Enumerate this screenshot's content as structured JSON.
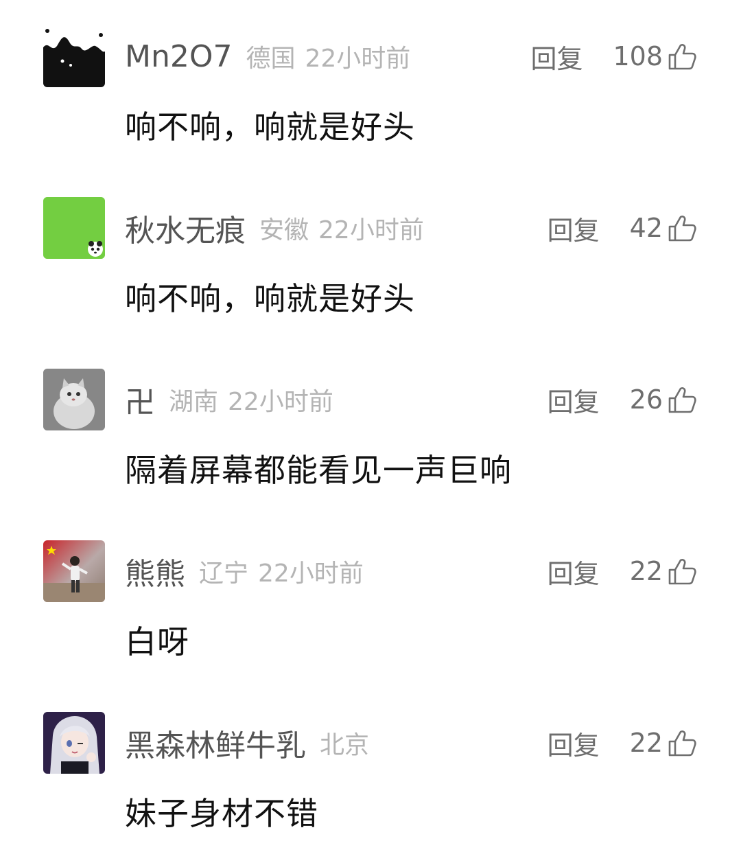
{
  "comments": [
    {
      "username": "Mn2O7",
      "location": "德国",
      "time": "22小时前",
      "reply_label": "回复",
      "likes": "108",
      "text": "响不响，响就是好头",
      "avatar_icon": "black-ink-splash-avatar",
      "avatar_color": "#111111"
    },
    {
      "username": "秋水无痕",
      "location": "安徽",
      "time": "22小时前",
      "reply_label": "回复",
      "likes": "42",
      "text": "响不响，响就是好头",
      "avatar_icon": "green-grass-with-panda-avatar",
      "avatar_color": "#6cc83c"
    },
    {
      "username": "卍",
      "location": "湖南",
      "time": "22小时前",
      "reply_label": "回复",
      "likes": "26",
      "text": "隔着屏幕都能看见一声巨响",
      "avatar_icon": "grey-cat-avatar",
      "avatar_color": "#8a8a8a"
    },
    {
      "username": "熊熊",
      "location": "辽宁",
      "time": "22小时前",
      "reply_label": "回复",
      "likes": "22",
      "text": "白呀",
      "avatar_icon": "flag-beach-person-avatar",
      "avatar_color": "#c8242a"
    },
    {
      "username": "黑森林鲜牛乳",
      "location": "北京",
      "time": "",
      "reply_label": "回复",
      "likes": "22",
      "text": "妹子身材不错",
      "avatar_icon": "anime-girl-avatar",
      "avatar_color": "#3a2a5a"
    }
  ]
}
